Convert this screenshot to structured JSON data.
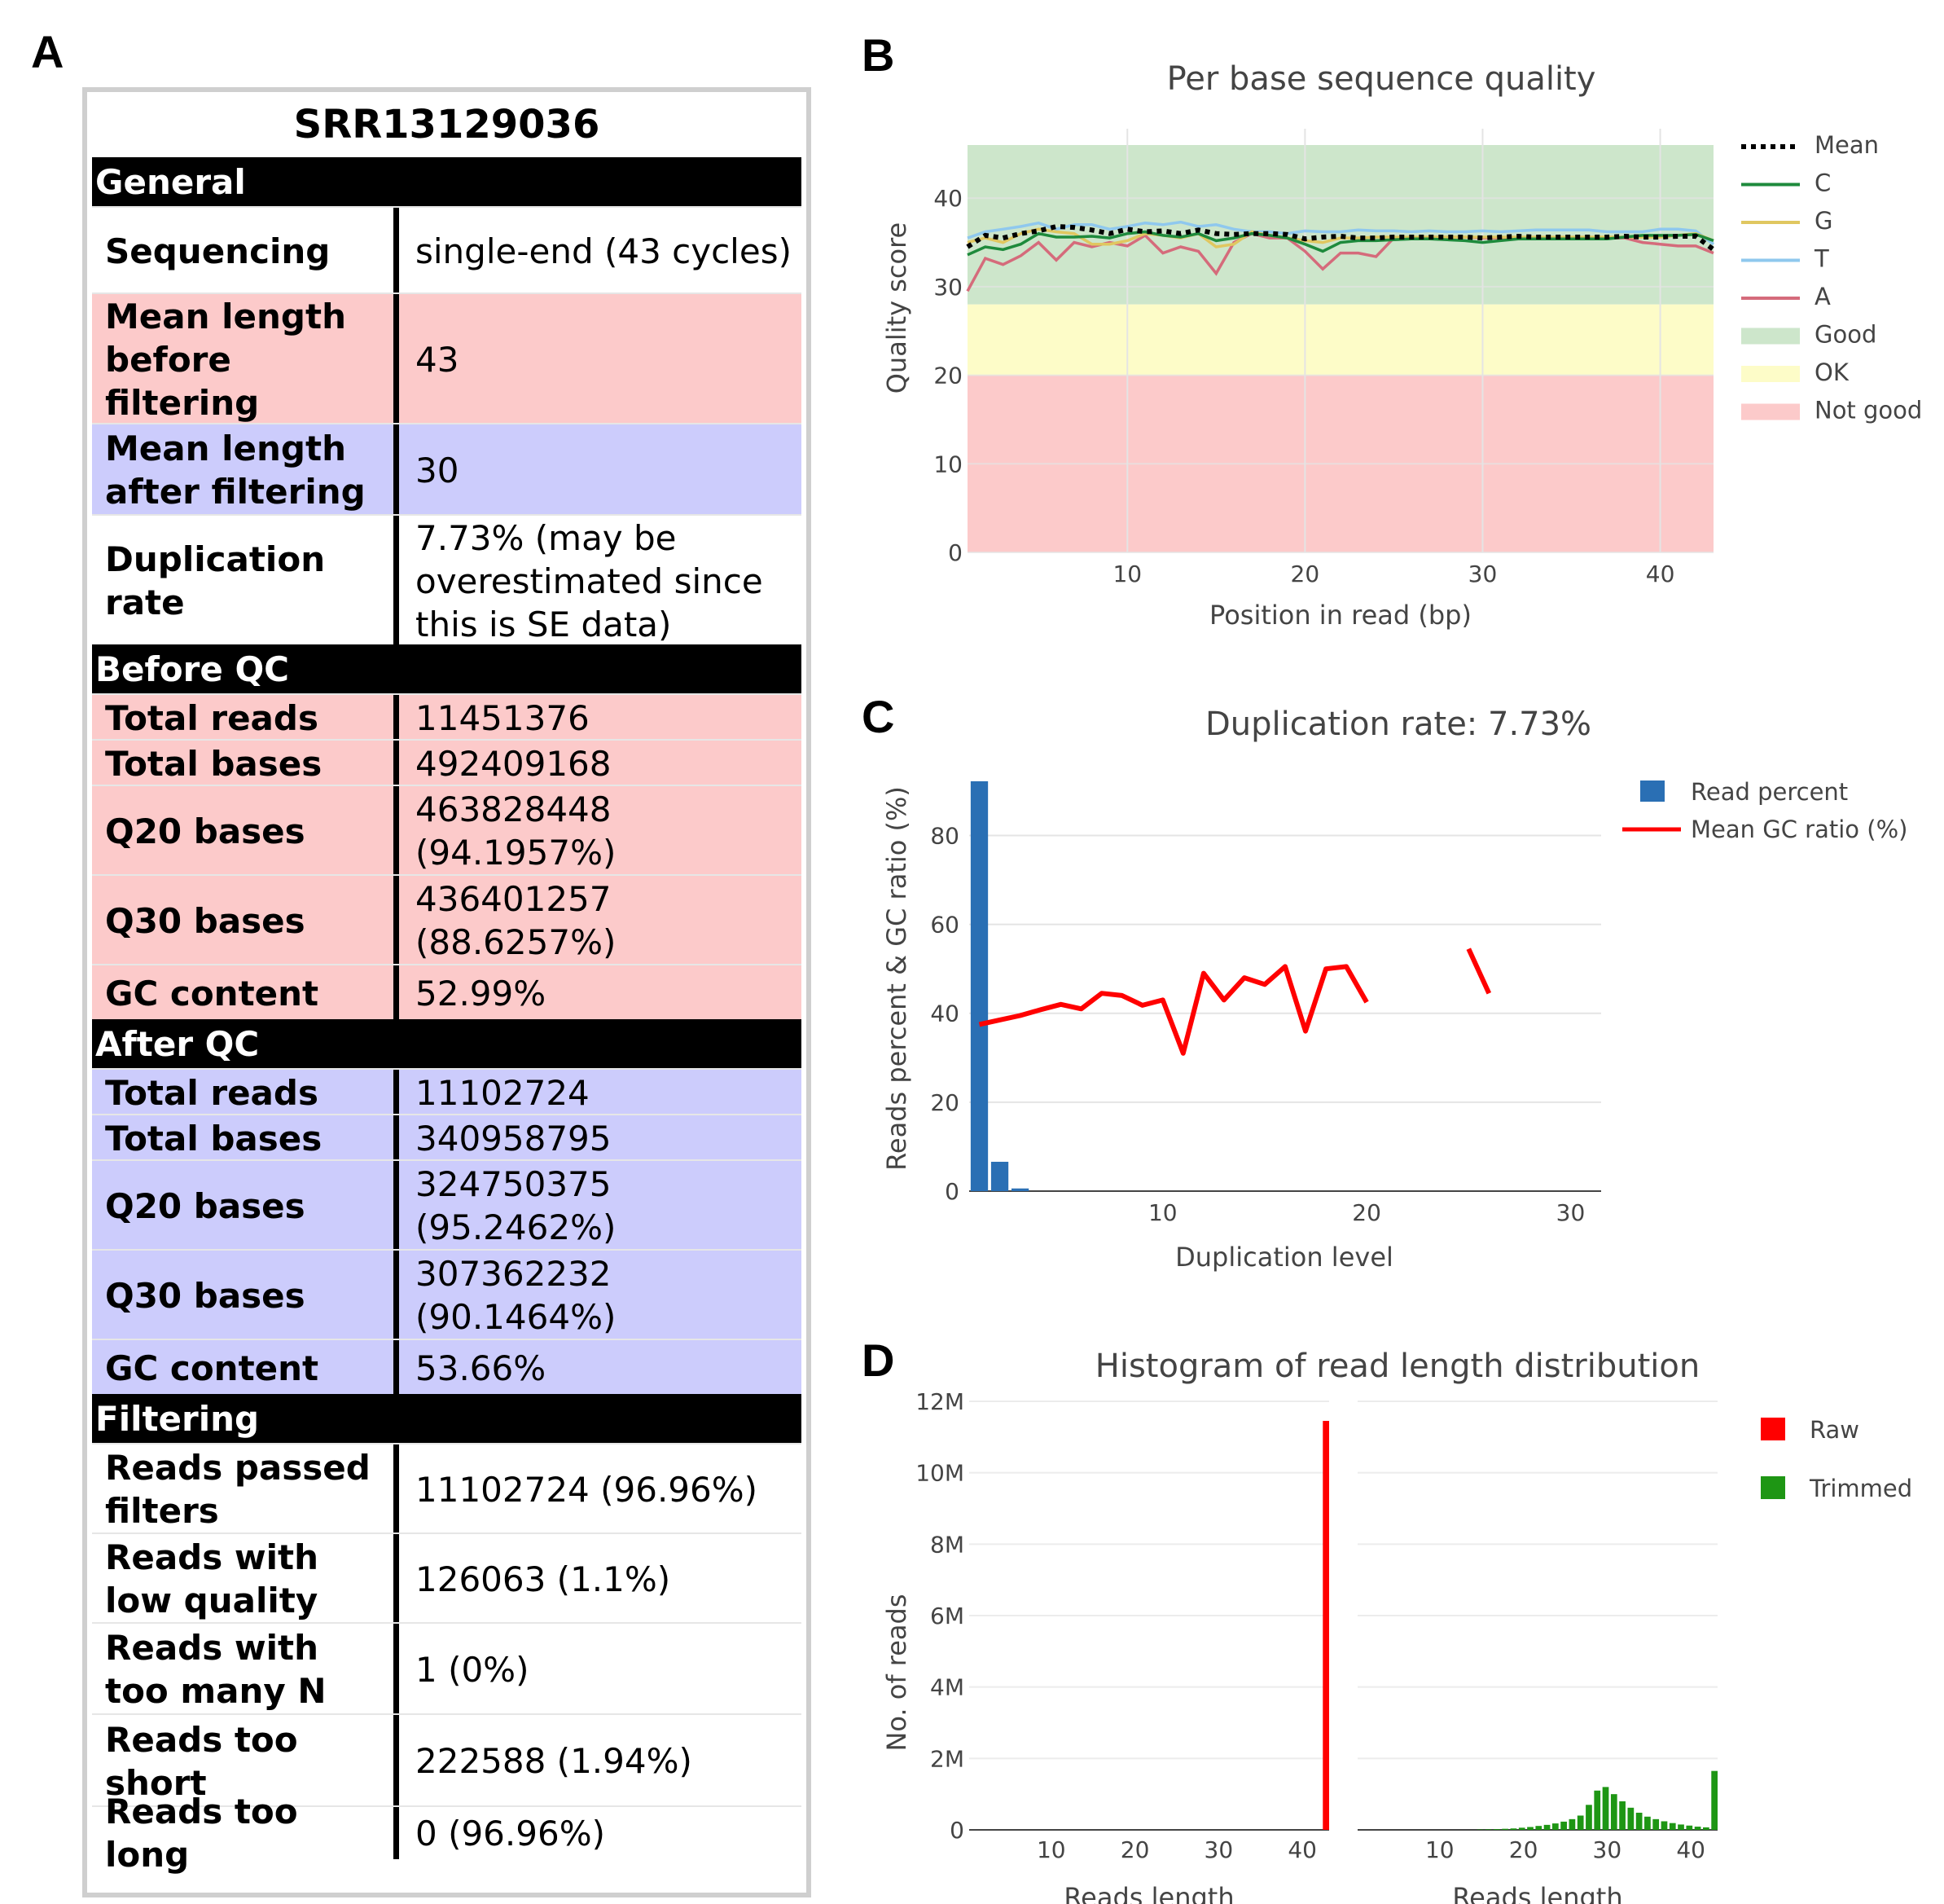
{
  "panels": {
    "a": "A",
    "b": "B",
    "c": "C",
    "d": "D"
  },
  "table": {
    "title": "SRR13129036",
    "sections": [
      {
        "header": "General",
        "rows": [
          {
            "label": "Sequencing",
            "value": "single-end (43 cycles)",
            "shade": "white"
          },
          {
            "label": "Mean length before filtering",
            "value": "43",
            "shade": "pink"
          },
          {
            "label": "Mean length after filtering",
            "value": "30",
            "shade": "blue"
          },
          {
            "label": "Duplication rate",
            "value": "7.73% (may be overestimated since this is SE data)",
            "shade": "white"
          }
        ]
      },
      {
        "header": "Before QC",
        "rows": [
          {
            "label": "Total reads",
            "value": "11451376",
            "shade": "pink"
          },
          {
            "label": "Total bases",
            "value": "492409168",
            "shade": "pink"
          },
          {
            "label": "Q20 bases",
            "value": "463828448 (94.1957%)",
            "shade": "pink"
          },
          {
            "label": "Q30 bases",
            "value": "436401257 (88.6257%)",
            "shade": "pink"
          },
          {
            "label": "GC content",
            "value": "52.99%",
            "shade": "pink"
          }
        ]
      },
      {
        "header": "After QC",
        "rows": [
          {
            "label": "Total reads",
            "value": "11102724",
            "shade": "blue"
          },
          {
            "label": "Total bases",
            "value": "340958795",
            "shade": "blue"
          },
          {
            "label": "Q20 bases",
            "value": "324750375 (95.2462%)",
            "shade": "blue"
          },
          {
            "label": "Q30 bases",
            "value": "307362232 (90.1464%)",
            "shade": "blue"
          },
          {
            "label": "GC content",
            "value": "53.66%",
            "shade": "blue"
          }
        ]
      },
      {
        "header": "Filtering",
        "rows": [
          {
            "label": "Reads passed filters",
            "value": "11102724 (96.96%)",
            "shade": "white"
          },
          {
            "label": "Reads with low quality",
            "value": "126063 (1.1%)",
            "shade": "white"
          },
          {
            "label": "Reads with too many N",
            "value": "1 (0%)",
            "shade": "white"
          },
          {
            "label": "Reads too short",
            "value": "222588 (1.94%)",
            "shade": "white"
          },
          {
            "label": "Reads too long",
            "value": "0 (96.96%)",
            "shade": "white"
          }
        ]
      }
    ]
  },
  "chart_data": [
    {
      "type": "line",
      "title": "Per base sequence quality",
      "xlabel": "Position in read (bp)",
      "ylabel": "Quality score",
      "xlim": [
        1,
        43
      ],
      "ylim": [
        0,
        46
      ],
      "xticks": [
        10,
        20,
        30,
        40
      ],
      "yticks": [
        0,
        10,
        20,
        30,
        40
      ],
      "bands": [
        {
          "name": "Good",
          "from": 28,
          "to": 46,
          "color": "#cde6cb"
        },
        {
          "name": "OK",
          "from": 20,
          "to": 28,
          "color": "#fdfcc8"
        },
        {
          "name": "Not good",
          "from": 0,
          "to": 20,
          "color": "#fccaca"
        }
      ],
      "x": [
        1,
        2,
        3,
        4,
        5,
        6,
        7,
        8,
        9,
        10,
        11,
        12,
        13,
        14,
        15,
        16,
        17,
        18,
        19,
        20,
        21,
        22,
        23,
        24,
        25,
        26,
        27,
        28,
        29,
        30,
        31,
        32,
        33,
        34,
        35,
        36,
        37,
        38,
        39,
        40,
        41,
        42,
        43
      ],
      "series": [
        {
          "name": "Mean",
          "color": "#000000",
          "dash": true,
          "values": [
            34.5,
            35.8,
            35.5,
            36.0,
            36.3,
            36.8,
            36.7,
            36.4,
            36.0,
            36.5,
            36.2,
            36.3,
            36.0,
            36.4,
            36.0,
            35.9,
            36.0,
            36.0,
            35.9,
            35.4,
            35.6,
            35.7,
            35.5,
            35.5,
            35.6,
            35.6,
            35.6,
            35.6,
            35.6,
            35.5,
            35.6,
            35.7,
            35.6,
            35.6,
            35.6,
            35.6,
            35.6,
            35.7,
            35.6,
            35.6,
            35.7,
            35.7,
            34.2
          ]
        },
        {
          "name": "C",
          "color": "#1e8a3c",
          "values": [
            33.6,
            34.5,
            34.2,
            34.8,
            36.0,
            35.6,
            35.6,
            35.7,
            35.5,
            36.0,
            36.2,
            35.8,
            35.6,
            36.0,
            35.2,
            35.5,
            36.0,
            35.8,
            35.5,
            34.8,
            34.0,
            35.0,
            35.2,
            35.2,
            35.3,
            35.4,
            35.4,
            35.3,
            35.2,
            35.0,
            35.2,
            35.4,
            35.4,
            35.4,
            35.4,
            35.4,
            35.4,
            35.6,
            35.8,
            35.8,
            35.8,
            35.9,
            35.2
          ]
        },
        {
          "name": "G",
          "color": "#e0c760",
          "values": [
            35.0,
            35.5,
            35.0,
            36.0,
            36.5,
            36.2,
            36.0,
            34.8,
            34.8,
            35.2,
            36.0,
            35.8,
            35.5,
            36.0,
            34.5,
            34.8,
            36.2,
            35.8,
            35.5,
            35.2,
            35.0,
            35.5,
            35.5,
            35.6,
            35.6,
            35.6,
            35.6,
            35.6,
            35.6,
            35.6,
            35.6,
            35.6,
            35.6,
            35.6,
            35.6,
            35.6,
            35.6,
            35.6,
            35.6,
            35.6,
            35.8,
            36.0,
            35.2
          ]
        },
        {
          "name": "T",
          "color": "#8fc8ee",
          "values": [
            35.5,
            36.2,
            36.5,
            36.8,
            37.2,
            36.5,
            37.0,
            37.0,
            36.5,
            36.8,
            37.2,
            37.0,
            37.3,
            36.8,
            37.0,
            36.5,
            36.2,
            36.2,
            36.0,
            36.3,
            36.2,
            36.2,
            36.4,
            36.3,
            36.3,
            36.2,
            36.3,
            36.2,
            36.2,
            36.3,
            36.2,
            36.3,
            36.4,
            36.4,
            36.4,
            36.4,
            36.2,
            36.2,
            36.2,
            36.5,
            36.5,
            36.3,
            34.8
          ]
        },
        {
          "name": "A",
          "color": "#d56b7b",
          "values": [
            29.5,
            33.2,
            32.5,
            33.5,
            35.0,
            33.0,
            35.0,
            34.5,
            35.0,
            34.6,
            35.8,
            33.8,
            34.5,
            34.0,
            31.5,
            35.0,
            36.0,
            35.5,
            35.5,
            34.0,
            32.0,
            33.8,
            33.8,
            33.4,
            35.5,
            35.5,
            35.6,
            35.6,
            35.6,
            35.5,
            35.5,
            35.4,
            35.4,
            35.4,
            35.4,
            35.4,
            35.5,
            35.5,
            35.0,
            34.8,
            34.6,
            34.6,
            33.8
          ]
        }
      ],
      "legend": [
        {
          "label": "Mean",
          "kind": "dots",
          "color": "#000000"
        },
        {
          "label": "C",
          "kind": "line",
          "color": "#1e8a3c"
        },
        {
          "label": "G",
          "kind": "line",
          "color": "#e0c760"
        },
        {
          "label": "T",
          "kind": "line",
          "color": "#8fc8ee"
        },
        {
          "label": "A",
          "kind": "line",
          "color": "#d56b7b"
        },
        {
          "label": "Good",
          "kind": "band",
          "color": "#cde6cb"
        },
        {
          "label": "OK",
          "kind": "band",
          "color": "#fdfcc8"
        },
        {
          "label": "Not good",
          "kind": "band",
          "color": "#fccaca"
        }
      ],
      "legend_position": "right"
    },
    {
      "type": "bar",
      "title": "Duplication rate: 7.73%",
      "xlabel": "Duplication level",
      "ylabel": "Reads percent & GC ratio (%)",
      "xlim": [
        0.5,
        31.5
      ],
      "ylim": [
        0,
        92
      ],
      "xticks": [
        10,
        20,
        30
      ],
      "yticks": [
        0,
        20,
        40,
        60,
        80
      ],
      "bars": {
        "name": "Read percent",
        "color": "#2a6fb4",
        "x": [
          1,
          2,
          3
        ],
        "values": [
          92.2,
          6.6,
          0.6
        ]
      },
      "line": {
        "name": "Mean GC ratio (%)",
        "color": "#ff0000",
        "segments": [
          [
            [
              1,
              37.5
            ],
            [
              2,
              38.5
            ],
            [
              3,
              39.5
            ],
            [
              4,
              40.8
            ],
            [
              5,
              42.0
            ],
            [
              6,
              41.0
            ],
            [
              7,
              44.5
            ],
            [
              8,
              44.0
            ],
            [
              9,
              41.8
            ],
            [
              10,
              43.0
            ],
            [
              11,
              31.0
            ],
            [
              12,
              49.0
            ],
            [
              13,
              43.0
            ],
            [
              14,
              48.0
            ],
            [
              15,
              46.5
            ],
            [
              16,
              50.5
            ],
            [
              17,
              36.0
            ],
            [
              18,
              50.0
            ],
            [
              19,
              50.5
            ],
            [
              20,
              42.5
            ]
          ],
          [
            [
              25,
              54.5
            ],
            [
              26,
              44.5
            ]
          ]
        ]
      },
      "legend_position": "top-right"
    },
    {
      "type": "bar",
      "title": "Histogram of read length distribution",
      "xlabel": "Reads length",
      "ylabel": "No. of reads",
      "ylim": [
        0,
        12000000
      ],
      "ytick_labels": [
        "0",
        "2M",
        "4M",
        "6M",
        "8M",
        "10M",
        "12M"
      ],
      "yticks": [
        0,
        2000000,
        4000000,
        6000000,
        8000000,
        10000000,
        12000000
      ],
      "xticks": [
        10,
        20,
        30,
        40
      ],
      "xlim": [
        0,
        43
      ],
      "series": [
        {
          "name": "Raw",
          "color": "#ff0000",
          "x": [
            43
          ],
          "values": [
            11451376
          ]
        },
        {
          "name": "Trimmed",
          "color": "#1e9614",
          "x": [
            15,
            16,
            17,
            18,
            19,
            20,
            21,
            22,
            23,
            24,
            25,
            26,
            27,
            28,
            29,
            30,
            31,
            32,
            33,
            34,
            35,
            36,
            37,
            38,
            39,
            40,
            41,
            42,
            43
          ],
          "values": [
            10000,
            15000,
            20000,
            30000,
            40000,
            60000,
            80000,
            110000,
            140000,
            180000,
            230000,
            300000,
            400000,
            700000,
            1100000,
            1200000,
            1000000,
            800000,
            620000,
            480000,
            370000,
            300000,
            240000,
            190000,
            150000,
            120000,
            90000,
            70000,
            1650000
          ]
        }
      ],
      "legend_position": "top-right"
    }
  ]
}
